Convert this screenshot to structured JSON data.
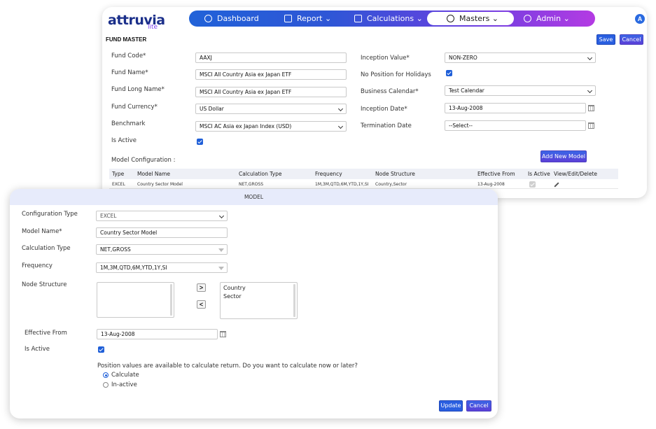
{
  "app": {
    "logo": "attruvia",
    "logo_sub": "lite",
    "user_initial": "A"
  },
  "nav": {
    "dashboard": "Dashboard",
    "report": "Report",
    "calculations": "Calculations",
    "masters": "Masters",
    "admin": "Admin"
  },
  "fund_master": {
    "title": "FUND MASTER",
    "save": "Save",
    "cancel": "Cancel",
    "fund_code_label": "Fund Code*",
    "fund_code": "AAXJ",
    "fund_name_label": "Fund Name*",
    "fund_name": "MSCI All Country Asia ex Japan ETF",
    "fund_long_name_label": "Fund Long Name*",
    "fund_long_name": "MSCI All Country Asia ex Japan ETF",
    "fund_currency_label": "Fund Currency*",
    "fund_currency": "US Dollar",
    "benchmark_label": "Benchmark",
    "benchmark": "MSCI AC Asia ex Japan Index (USD)",
    "is_active_label": "Is Active",
    "inception_value_label": "Inception Value*",
    "inception_value": "NON-ZERO",
    "no_position_label": "No Position for Holidays",
    "business_calendar_label": "Business Calendar*",
    "business_calendar": "Test Calendar",
    "inception_date_label": "Inception Date*",
    "inception_date": "13-Aug-2008",
    "termination_date_label": "Termination Date",
    "termination_date": "--Select--",
    "model_config_label": "Model Configuration :",
    "add_model": "Add New Model",
    "table": {
      "headers": [
        "Type",
        "Model Name",
        "Calculation Type",
        "Frequency",
        "Node Structure",
        "Effective From",
        "Is Active",
        "View/Edit/Delete"
      ],
      "row": [
        "EXCEL",
        "Country Sector Model",
        "NET,GROSS",
        "1M,3M,QTD,6M,YTD,1Y,SI",
        "Country,Sector",
        "13-Aug-2008"
      ]
    }
  },
  "model": {
    "title": "MODEL",
    "config_type_label": "Configuration Type",
    "config_type": "EXCEL",
    "model_name_label": "Model Name*",
    "model_name": "Country Sector Model",
    "calc_type_label": "Calculation Type",
    "calc_type": "NET,GROSS",
    "frequency_label": "Frequency",
    "frequency": "1M,3M,QTD,6M,YTD,1Y,SI",
    "node_structure_label": "Node Structure",
    "node_selected": [
      "Country",
      "Sector"
    ],
    "move_right": ">",
    "move_left": "<",
    "effective_from_label": "Effective From",
    "effective_from": "13-Aug-2008",
    "is_active_label": "Is Active",
    "position_question": "Position values are available to calculate return. Do you want to calculate now or later?",
    "option_calculate": "Calculate",
    "option_inactive": "In-active",
    "update": "Update",
    "cancel": "Cancel"
  }
}
